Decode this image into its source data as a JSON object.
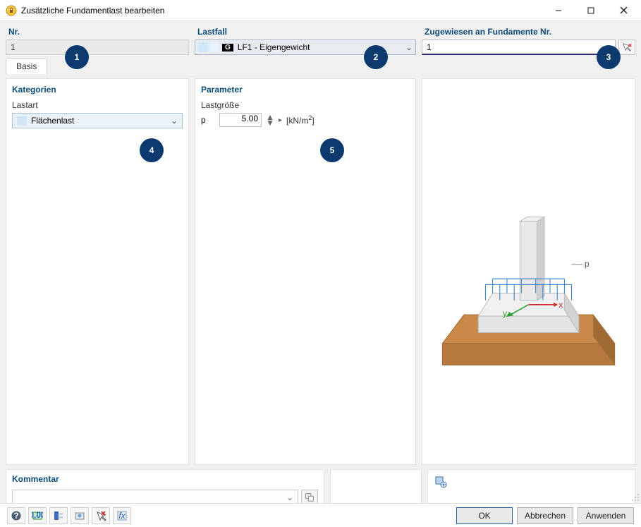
{
  "window": {
    "title": "Zusätzliche Fundamentlast bearbeiten"
  },
  "top": {
    "nr_label": "Nr.",
    "nr_value": "1",
    "lastfall_label": "Lastfall",
    "lastfall_value": "LF1 - Eigengewicht",
    "lastfall_badge": "G",
    "assign_label": "Zugewiesen an Fundamente Nr.",
    "assign_value": "1"
  },
  "tabs": {
    "basis": "Basis"
  },
  "categories": {
    "heading": "Kategorien",
    "lastart_label": "Lastart",
    "lastart_value": "Flächenlast"
  },
  "params": {
    "heading": "Parameter",
    "group_label": "Lastgröße",
    "symbol": "p",
    "value": "5.00",
    "unit_prefix": "[kN/m",
    "unit_exp": "2",
    "unit_suffix": "]"
  },
  "preview": {
    "p_label": "p",
    "x_label": "x",
    "y_label": "y"
  },
  "comment": {
    "heading": "Kommentar"
  },
  "buttons": {
    "ok": "OK",
    "cancel": "Abbrechen",
    "apply": "Anwenden"
  },
  "badges": {
    "b1": "1",
    "b2": "2",
    "b3": "3",
    "b4": "4",
    "b5": "5"
  }
}
